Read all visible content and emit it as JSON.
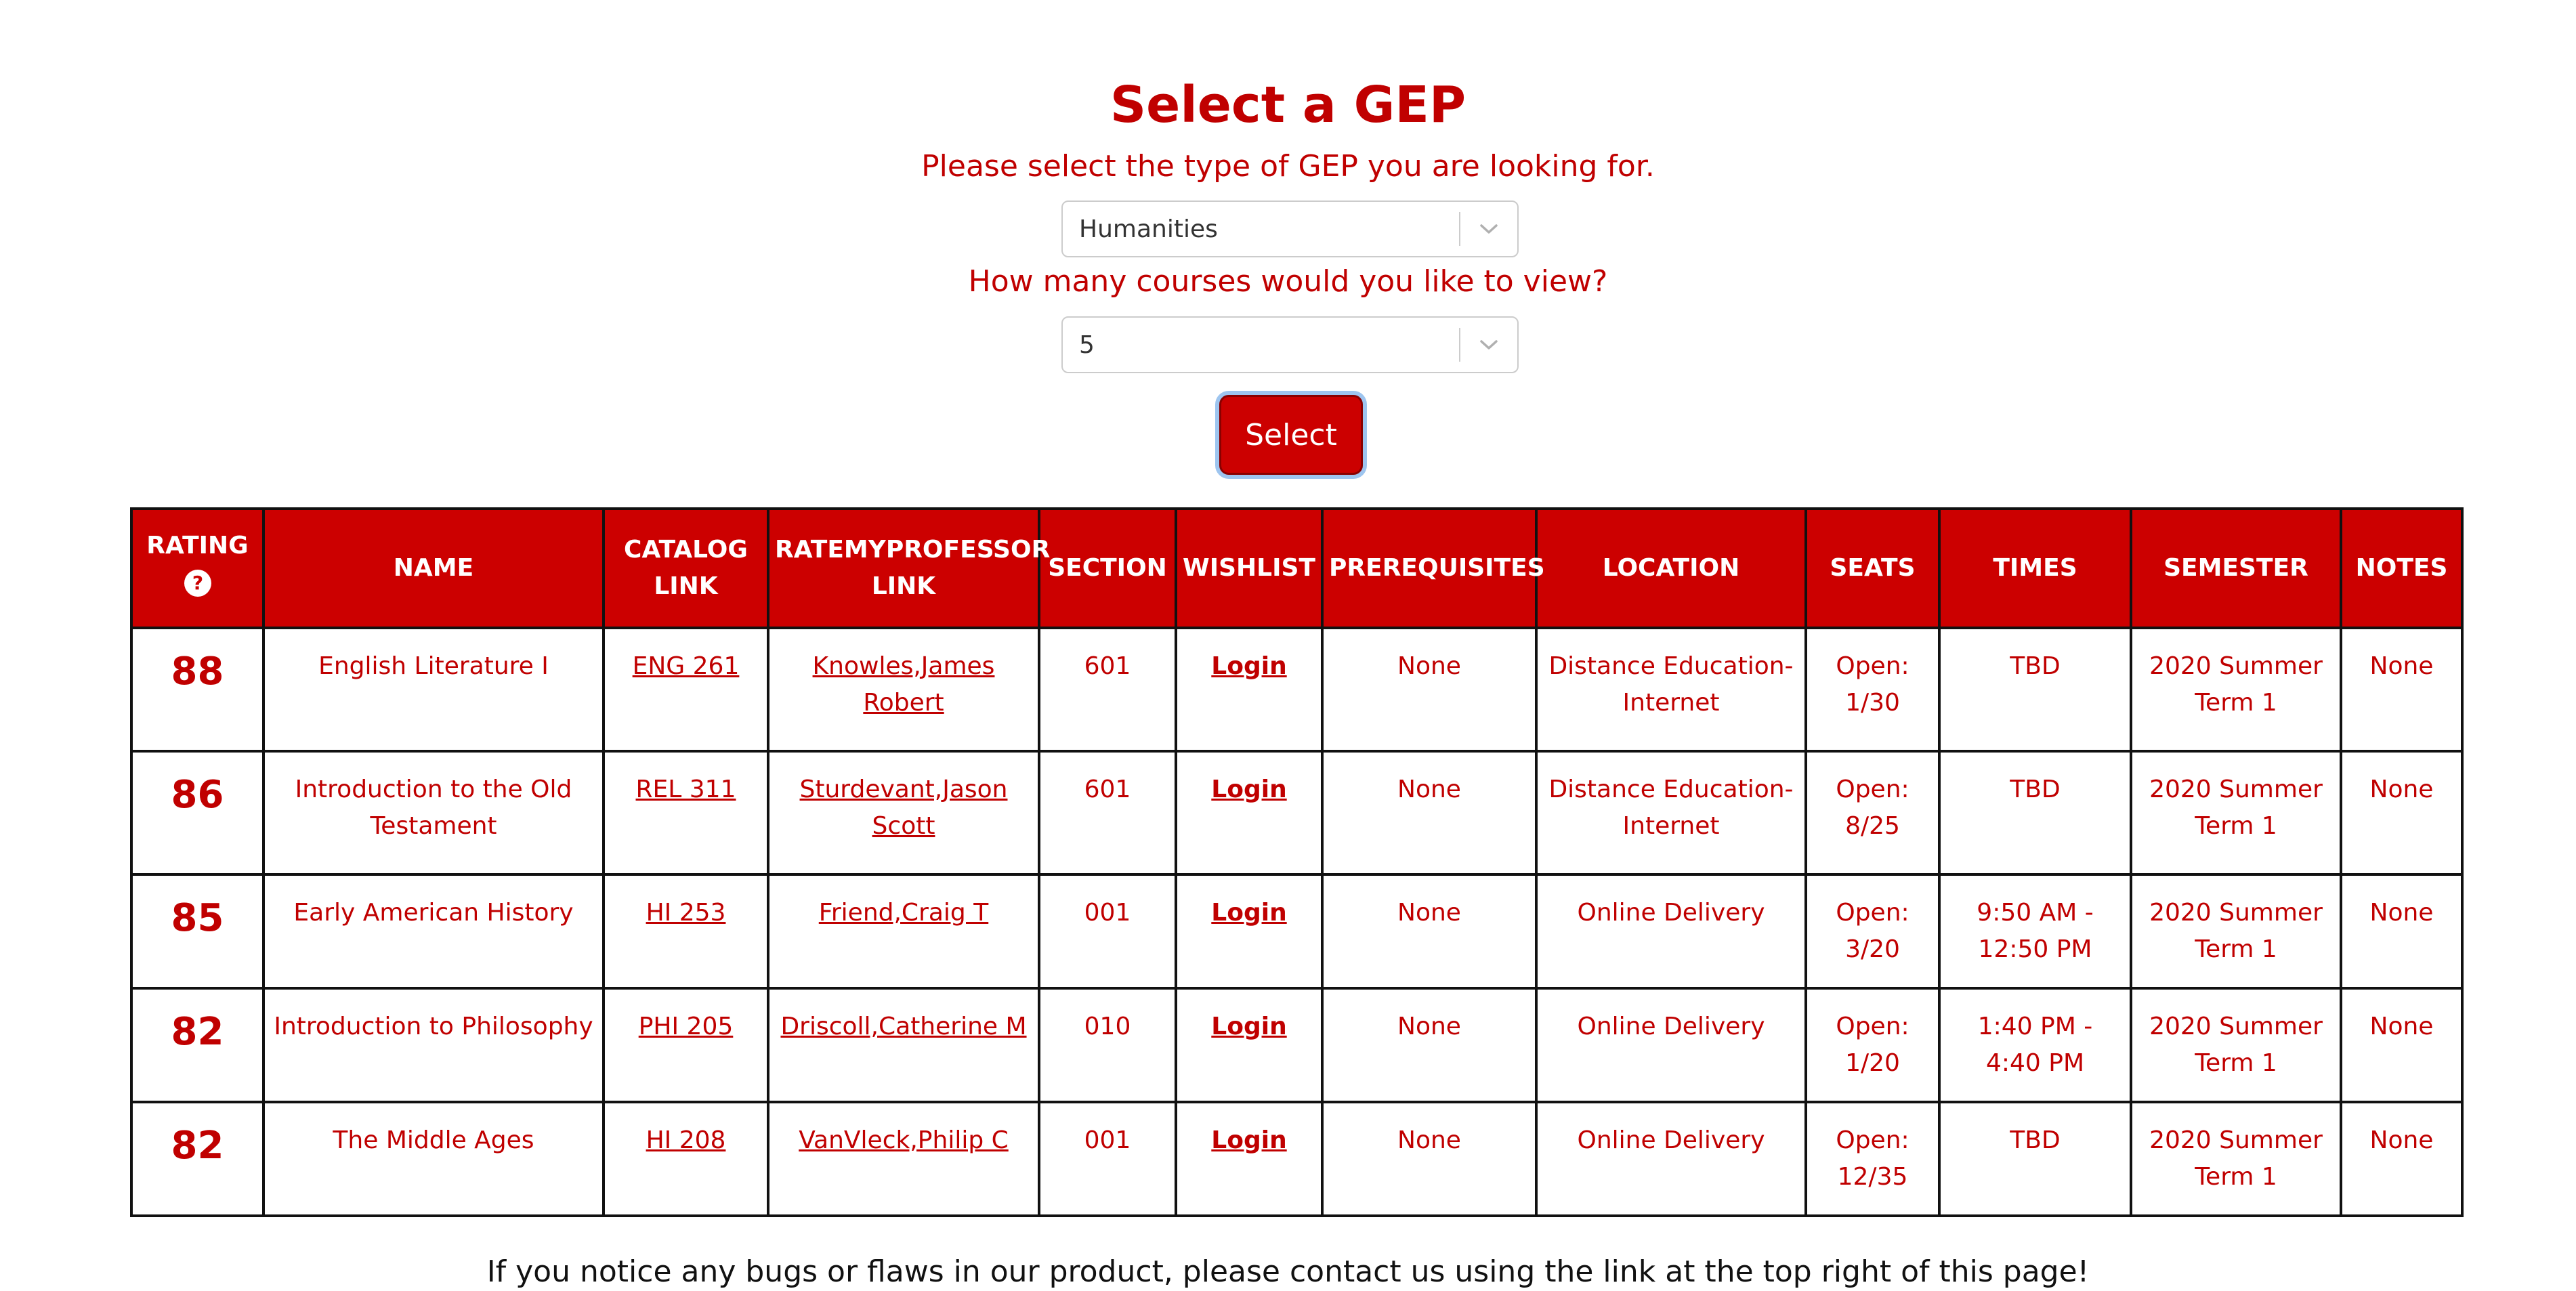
{
  "page": {
    "title": "Select a GEP",
    "gep_prompt": "Please select the type of GEP you are looking for.",
    "count_prompt": "How many courses would you like to view?",
    "footer": "If you notice any bugs or flaws in our product, please contact us using the link at the top right of this page!"
  },
  "gep_select": {
    "value": "Humanities",
    "icon": "chevron-down-icon"
  },
  "count_select": {
    "value": "5",
    "icon": "chevron-down-icon"
  },
  "select_button": {
    "label": "Select"
  },
  "table": {
    "headers": {
      "rating": "RATING",
      "name": "NAME",
      "catalog": "CATALOG LINK",
      "rmp": "RATEMYPROFESSOR LINK",
      "section": "SECTION",
      "wishlist": "WISHLIST",
      "prereq": "PREREQUISITES",
      "location": "LOCATION",
      "seats": "SEATS",
      "times": "TIMES",
      "semester": "SEMESTER",
      "notes": "NOTES"
    },
    "rating_help_icon": "question-circle-icon",
    "rows": [
      {
        "rating": "88",
        "name": "English Literature I",
        "catalog": "ENG 261",
        "professor": "Knowles,James Robert",
        "section": "601",
        "wishlist": "Login",
        "prereq": "None",
        "location": "Distance Education-Internet",
        "seats": "Open: 1/30",
        "times": "TBD",
        "semester": "2020 Summer Term 1",
        "notes": "None"
      },
      {
        "rating": "86",
        "name": "Introduction to the Old Testament",
        "catalog": "REL 311",
        "professor": "Sturdevant,Jason Scott",
        "section": "601",
        "wishlist": "Login",
        "prereq": "None",
        "location": "Distance Education-Internet",
        "seats": "Open: 8/25",
        "times": "TBD",
        "semester": "2020 Summer Term 1",
        "notes": "None"
      },
      {
        "rating": "85",
        "name": "Early American History",
        "catalog": "HI 253",
        "professor": "Friend,Craig T",
        "section": "001",
        "wishlist": "Login",
        "prereq": "None",
        "location": "Online Delivery",
        "seats": "Open: 3/20",
        "times": "9:50 AM - 12:50 PM",
        "semester": "2020 Summer Term 1",
        "notes": "None"
      },
      {
        "rating": "82",
        "name": "Introduction to Philosophy",
        "catalog": "PHI 205",
        "professor": "Driscoll,Catherine M",
        "section": "010",
        "wishlist": "Login",
        "prereq": "None",
        "location": "Online Delivery",
        "seats": "Open: 1/20",
        "times": "1:40 PM - 4:40 PM",
        "semester": "2020 Summer Term 1",
        "notes": "None"
      },
      {
        "rating": "82",
        "name": "The Middle Ages",
        "catalog": "HI 208",
        "professor": "VanVleck,Philip C",
        "section": "001",
        "wishlist": "Login",
        "prereq": "None",
        "location": "Online Delivery",
        "seats": "Open: 12/35",
        "times": "TBD",
        "semester": "2020 Summer Term 1",
        "notes": "None"
      }
    ]
  }
}
